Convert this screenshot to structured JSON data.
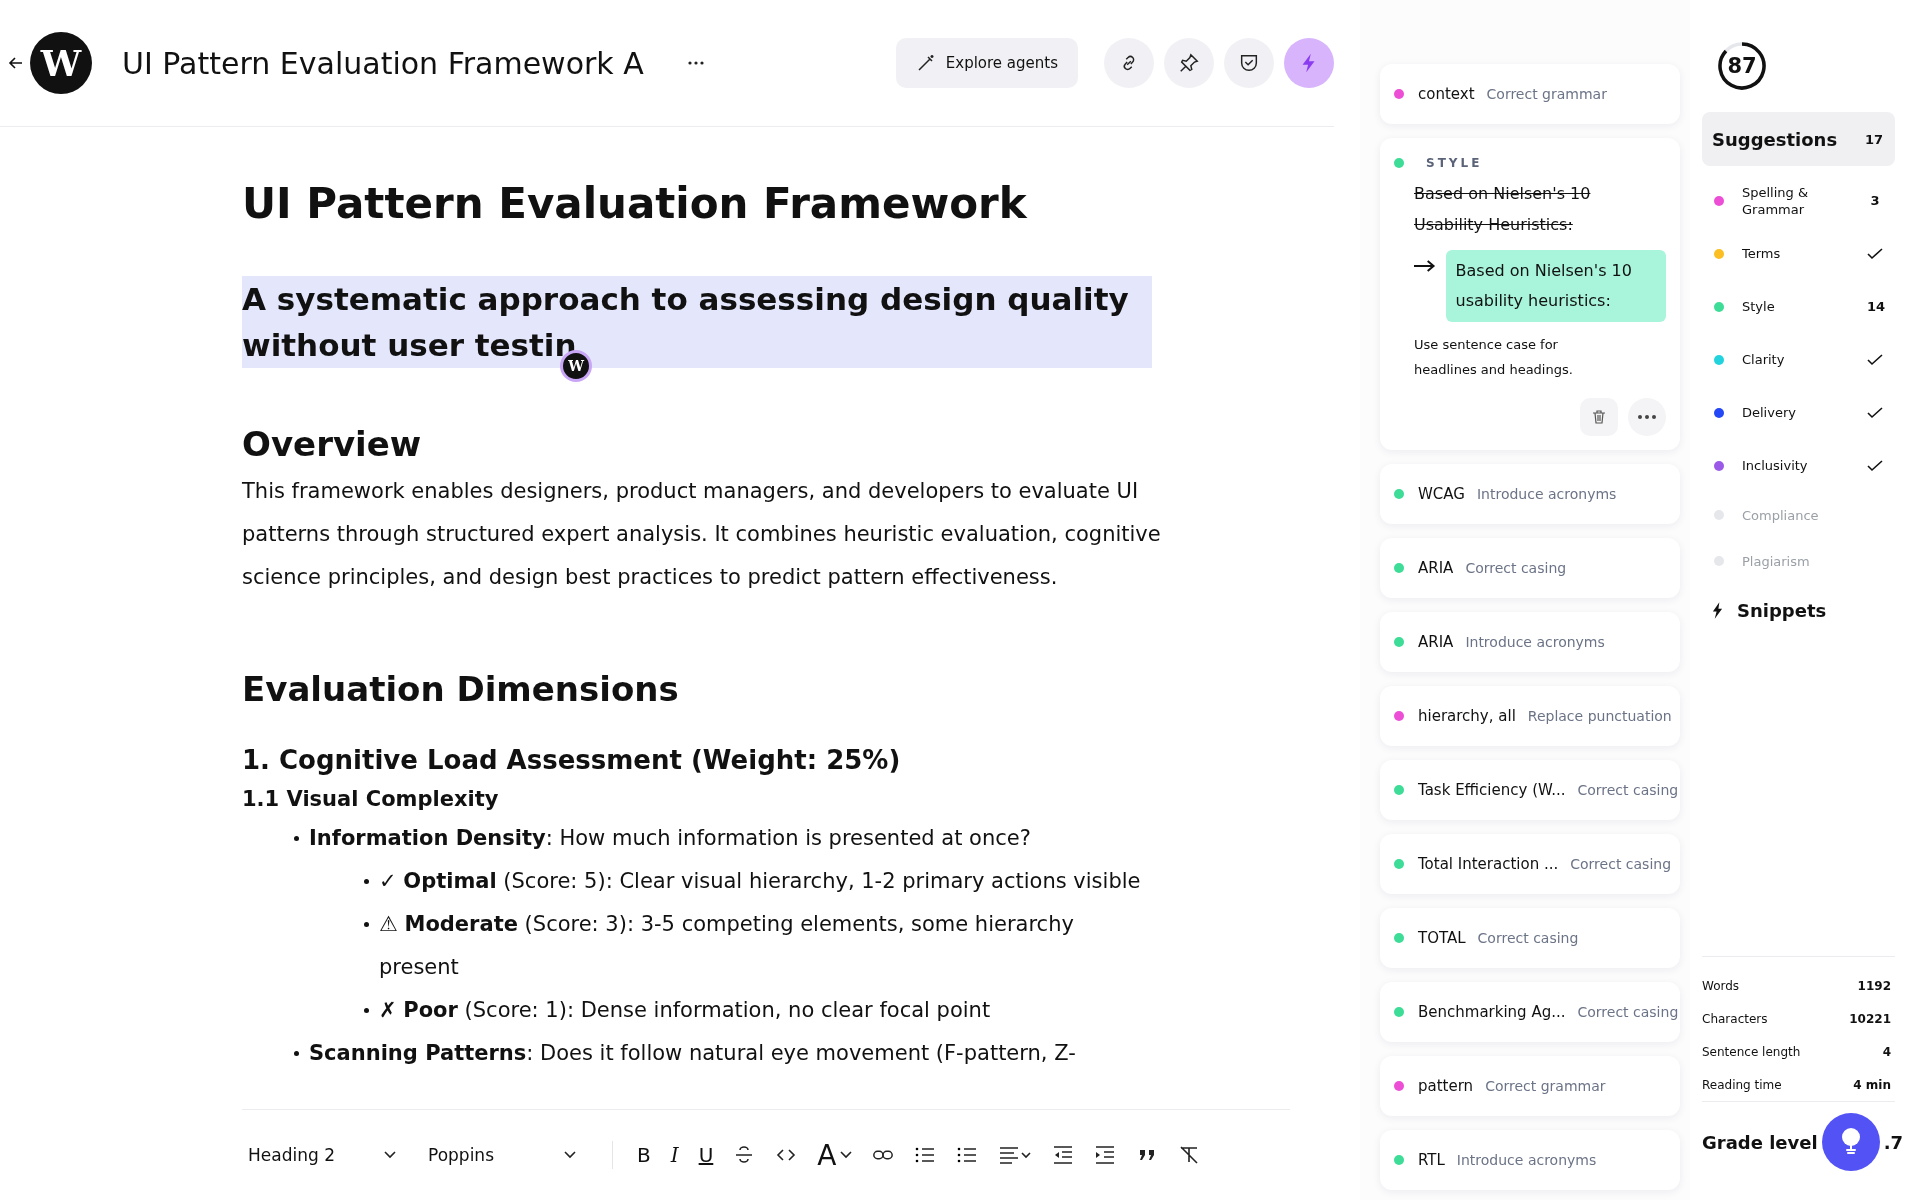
{
  "header": {
    "logo": "W",
    "title": "UI Pattern Evaluation Framework A",
    "explore_button": "Explore agents",
    "tools": [
      {
        "kind": "link",
        "selected": false
      },
      {
        "kind": "pin",
        "selected": false
      },
      {
        "kind": "shield",
        "selected": false
      },
      {
        "kind": "bolt",
        "selected": true
      }
    ]
  },
  "document": {
    "blocks": [
      {
        "kind": "h1",
        "text": "UI Pattern Evaluation Framework"
      },
      {
        "kind": "subtitle",
        "text": "A systematic approach to assessing design quality without user testin",
        "cursor": "W"
      },
      {
        "kind": "h2",
        "text": "Overview"
      },
      {
        "kind": "p",
        "text": "This framework enables designers, product managers, and developers to evaluate UI patterns through structured expert analysis. It combines heuristic evaluation, cognitive science principles, and design best practices to predict pattern effectiveness."
      },
      {
        "kind": "h2",
        "text": "Evaluation Dimensions"
      },
      {
        "kind": "h3",
        "text": "1. Cognitive Load Assessment (Weight: 25%)"
      },
      {
        "kind": "h4",
        "text": "1.1 Visual Complexity"
      },
      {
        "kind": "list",
        "items": [
          {
            "text": "**Information Density**: How much information is presented at once?",
            "children": [
              {
                "text": "✓ **Optimal** (Score: 5): Clear visual hierarchy, 1-2 primary actions visible"
              },
              {
                "text": "⚠ **Moderate** (Score: 3): 3-5 competing elements, some hierarchy present"
              },
              {
                "text": "✗ **Poor** (Score: 1): Dense information, no clear focal point"
              }
            ]
          },
          {
            "text": "**Scanning Patterns**: Does it follow natural eye movement (F-pattern, Z-"
          }
        ]
      }
    ]
  },
  "toolbar": {
    "block_style": "Heading 2",
    "font": "Poppins",
    "buttons": [
      {
        "kind": "bold",
        "label": "B"
      },
      {
        "kind": "italic",
        "label": "I"
      },
      {
        "kind": "underline",
        "label": "U"
      },
      {
        "kind": "strike"
      },
      {
        "kind": "code"
      },
      {
        "kind": "size",
        "label": "A"
      },
      {
        "kind": "link"
      },
      {
        "kind": "bullets"
      },
      {
        "kind": "numbers"
      },
      {
        "kind": "align"
      },
      {
        "kind": "outdent"
      },
      {
        "kind": "indent"
      },
      {
        "kind": "quote"
      },
      {
        "kind": "clear"
      }
    ]
  },
  "suggestions": [
    {
      "kind": "collapsed",
      "color": "#ec4fd6",
      "term": "context",
      "action": "Correct grammar"
    },
    {
      "kind": "expanded",
      "color": "#3ddc97",
      "category": "STYLE",
      "original": "Based on Nielsen's 10 Usability Heuristics:",
      "replacement": "Based on Nielsen's 10 usability heuristics:",
      "note": "Use sentence case for headlines and headings."
    },
    {
      "kind": "collapsed",
      "color": "#3ddc97",
      "term": "WCAG",
      "action": "Introduce acronyms"
    },
    {
      "kind": "collapsed",
      "color": "#3ddc97",
      "term": "ARIA",
      "action": "Correct casing"
    },
    {
      "kind": "collapsed",
      "color": "#3ddc97",
      "term": "ARIA",
      "action": "Introduce acronyms"
    },
    {
      "kind": "collapsed",
      "color": "#ec4fd6",
      "term": "hierarchy, all",
      "action": "Replace punctuation"
    },
    {
      "kind": "collapsed",
      "color": "#3ddc97",
      "term": "Task Efficiency (W...",
      "action": "Correct casing"
    },
    {
      "kind": "collapsed",
      "color": "#3ddc97",
      "term": "Total Interaction ...",
      "action": "Correct casing"
    },
    {
      "kind": "collapsed",
      "color": "#3ddc97",
      "term": "TOTAL",
      "action": "Correct casing"
    },
    {
      "kind": "collapsed",
      "color": "#3ddc97",
      "term": "Benchmarking Ag...",
      "action": "Correct casing"
    },
    {
      "kind": "collapsed",
      "color": "#ec4fd6",
      "term": "pattern",
      "action": "Correct grammar"
    },
    {
      "kind": "collapsed",
      "color": "#3ddc97",
      "term": "RTL",
      "action": "Introduce acronyms"
    }
  ],
  "sidebar": {
    "score": {
      "value": "87",
      "level": 0.87
    },
    "suggestions_tab": {
      "label": "Suggestions",
      "count": "17",
      "selected": true
    },
    "categories": [
      {
        "label": "Spelling & Grammar",
        "color": "#ec4fd6",
        "count": "3",
        "done": false,
        "disabled": false
      },
      {
        "label": "Terms",
        "color": "#fbbf24",
        "done": true,
        "disabled": false
      },
      {
        "label": "Style",
        "color": "#3ddc97",
        "count": "14",
        "done": false,
        "disabled": false
      },
      {
        "label": "Clarity",
        "color": "#22d3dd",
        "done": true,
        "disabled": false
      },
      {
        "label": "Delivery",
        "color": "#2448f5",
        "done": true,
        "disabled": false
      },
      {
        "label": "Inclusivity",
        "color": "#9b59e8",
        "done": true,
        "disabled": false
      },
      {
        "label": "Compliance",
        "color": "#e5e7eb",
        "done": false,
        "disabled": true
      },
      {
        "label": "Plagiarism",
        "color": "#e5e7eb",
        "done": false,
        "disabled": true
      }
    ],
    "snippets_tab": {
      "label": "Snippets",
      "selected": false
    },
    "stats": [
      {
        "label": "Words",
        "value": "1192"
      },
      {
        "label": "Characters",
        "value": "10221"
      },
      {
        "label": "Sentence length",
        "value": "4"
      },
      {
        "label": "Reading time",
        "value": "4 min"
      }
    ],
    "grade": {
      "label": "Grade level",
      "value": ".7"
    }
  }
}
